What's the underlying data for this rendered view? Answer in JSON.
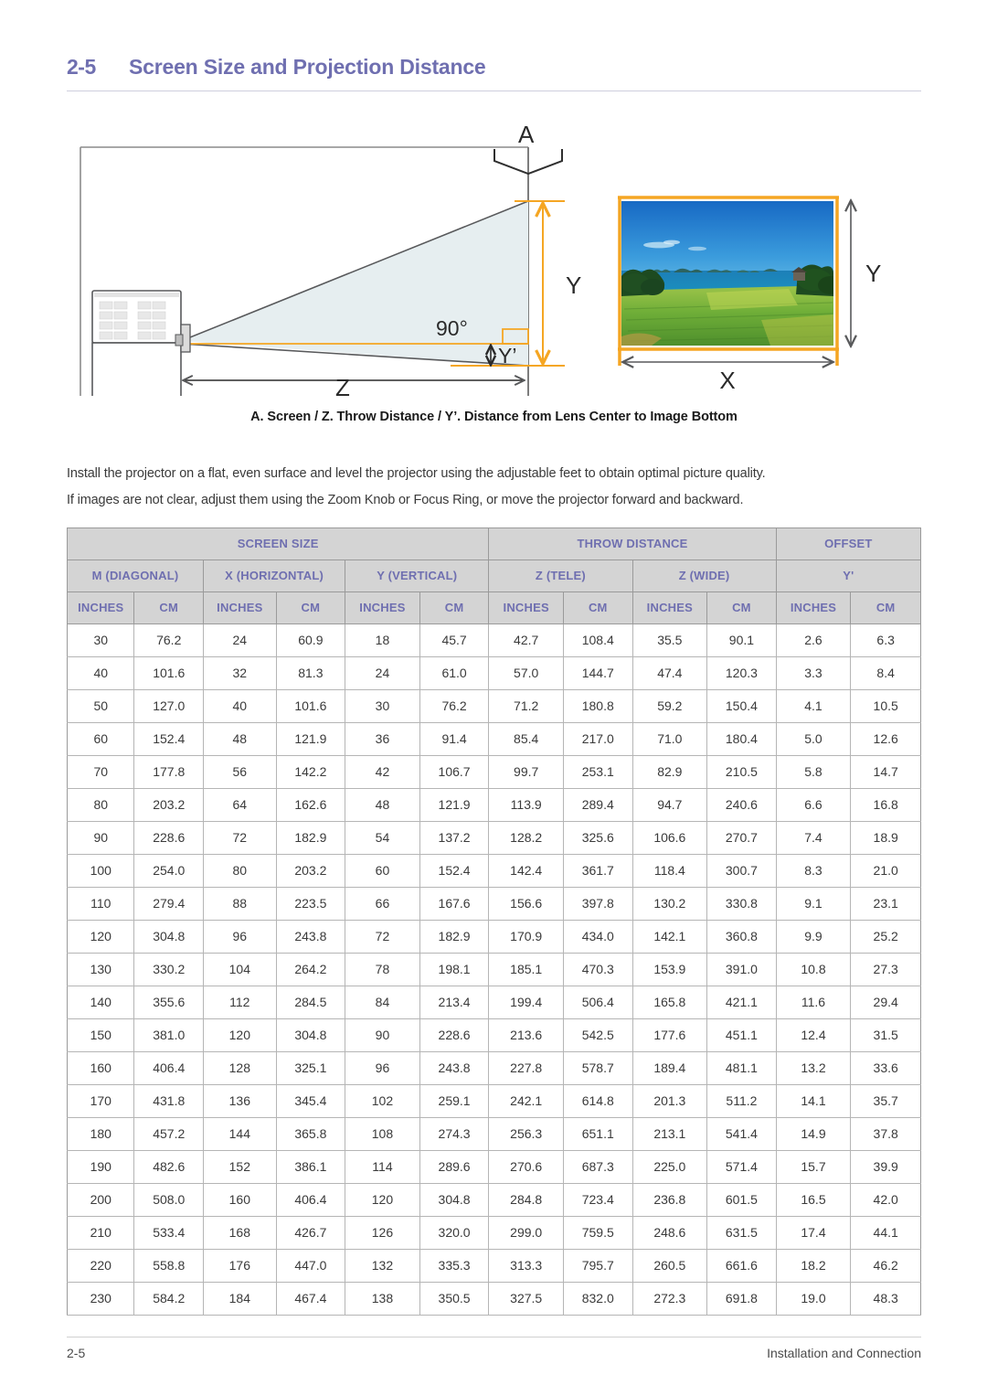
{
  "header": {
    "section_number": "2-5",
    "title": "Screen Size and Projection Distance"
  },
  "figure": {
    "caption": "A. Screen / Z. Throw Distance / Y’. Distance from Lens Center to Image Bottom",
    "labels": {
      "a": "A",
      "y": "Y",
      "y_prime": "Y’",
      "z": "Z",
      "angle": "90°",
      "screen_y": "Y",
      "screen_x": "X"
    },
    "colors": {
      "accent_orange": "#F5A623",
      "beam_fill": "#E6EEF0",
      "line_gray": "#58595B"
    }
  },
  "body": {
    "paragraph1": "Install the projector on a flat, even surface and level the projector using the adjustable feet to obtain optimal picture quality.",
    "paragraph2": "If images are not clear, adjust them using the Zoom Knob or Focus Ring, or move the projector forward and backward."
  },
  "table": {
    "group_headers": [
      {
        "label": "SCREEN SIZE",
        "span": 6
      },
      {
        "label": "THROW DISTANCE",
        "span": 4
      },
      {
        "label": "OFFSET",
        "span": 2
      }
    ],
    "sub_headers": [
      {
        "label": "M (DIAGONAL)",
        "span": 2
      },
      {
        "label": "X (HORIZONTAL)",
        "span": 2
      },
      {
        "label": "Y (VERTICAL)",
        "span": 2
      },
      {
        "label": "Z (TELE)",
        "span": 2
      },
      {
        "label": "Z (WIDE)",
        "span": 2
      },
      {
        "label": "Y'",
        "span": 2
      }
    ],
    "unit_headers": [
      "INCHES",
      "CM",
      "INCHES",
      "CM",
      "INCHES",
      "CM",
      "INCHES",
      "CM",
      "INCHES",
      "CM",
      "INCHES",
      "CM"
    ],
    "rows": [
      [
        "30",
        "76.2",
        "24",
        "60.9",
        "18",
        "45.7",
        "42.7",
        "108.4",
        "35.5",
        "90.1",
        "2.6",
        "6.3"
      ],
      [
        "40",
        "101.6",
        "32",
        "81.3",
        "24",
        "61.0",
        "57.0",
        "144.7",
        "47.4",
        "120.3",
        "3.3",
        "8.4"
      ],
      [
        "50",
        "127.0",
        "40",
        "101.6",
        "30",
        "76.2",
        "71.2",
        "180.8",
        "59.2",
        "150.4",
        "4.1",
        "10.5"
      ],
      [
        "60",
        "152.4",
        "48",
        "121.9",
        "36",
        "91.4",
        "85.4",
        "217.0",
        "71.0",
        "180.4",
        "5.0",
        "12.6"
      ],
      [
        "70",
        "177.8",
        "56",
        "142.2",
        "42",
        "106.7",
        "99.7",
        "253.1",
        "82.9",
        "210.5",
        "5.8",
        "14.7"
      ],
      [
        "80",
        "203.2",
        "64",
        "162.6",
        "48",
        "121.9",
        "113.9",
        "289.4",
        "94.7",
        "240.6",
        "6.6",
        "16.8"
      ],
      [
        "90",
        "228.6",
        "72",
        "182.9",
        "54",
        "137.2",
        "128.2",
        "325.6",
        "106.6",
        "270.7",
        "7.4",
        "18.9"
      ],
      [
        "100",
        "254.0",
        "80",
        "203.2",
        "60",
        "152.4",
        "142.4",
        "361.7",
        "118.4",
        "300.7",
        "8.3",
        "21.0"
      ],
      [
        "110",
        "279.4",
        "88",
        "223.5",
        "66",
        "167.6",
        "156.6",
        "397.8",
        "130.2",
        "330.8",
        "9.1",
        "23.1"
      ],
      [
        "120",
        "304.8",
        "96",
        "243.8",
        "72",
        "182.9",
        "170.9",
        "434.0",
        "142.1",
        "360.8",
        "9.9",
        "25.2"
      ],
      [
        "130",
        "330.2",
        "104",
        "264.2",
        "78",
        "198.1",
        "185.1",
        "470.3",
        "153.9",
        "391.0",
        "10.8",
        "27.3"
      ],
      [
        "140",
        "355.6",
        "112",
        "284.5",
        "84",
        "213.4",
        "199.4",
        "506.4",
        "165.8",
        "421.1",
        "11.6",
        "29.4"
      ],
      [
        "150",
        "381.0",
        "120",
        "304.8",
        "90",
        "228.6",
        "213.6",
        "542.5",
        "177.6",
        "451.1",
        "12.4",
        "31.5"
      ],
      [
        "160",
        "406.4",
        "128",
        "325.1",
        "96",
        "243.8",
        "227.8",
        "578.7",
        "189.4",
        "481.1",
        "13.2",
        "33.6"
      ],
      [
        "170",
        "431.8",
        "136",
        "345.4",
        "102",
        "259.1",
        "242.1",
        "614.8",
        "201.3",
        "511.2",
        "14.1",
        "35.7"
      ],
      [
        "180",
        "457.2",
        "144",
        "365.8",
        "108",
        "274.3",
        "256.3",
        "651.1",
        "213.1",
        "541.4",
        "14.9",
        "37.8"
      ],
      [
        "190",
        "482.6",
        "152",
        "386.1",
        "114",
        "289.6",
        "270.6",
        "687.3",
        "225.0",
        "571.4",
        "15.7",
        "39.9"
      ],
      [
        "200",
        "508.0",
        "160",
        "406.4",
        "120",
        "304.8",
        "284.8",
        "723.4",
        "236.8",
        "601.5",
        "16.5",
        "42.0"
      ],
      [
        "210",
        "533.4",
        "168",
        "426.7",
        "126",
        "320.0",
        "299.0",
        "759.5",
        "248.6",
        "631.5",
        "17.4",
        "44.1"
      ],
      [
        "220",
        "558.8",
        "176",
        "447.0",
        "132",
        "335.3",
        "313.3",
        "795.7",
        "260.5",
        "661.6",
        "18.2",
        "46.2"
      ],
      [
        "230",
        "584.2",
        "184",
        "467.4",
        "138",
        "350.5",
        "327.5",
        "832.0",
        "272.3",
        "691.8",
        "19.0",
        "48.3"
      ]
    ]
  },
  "footer": {
    "left": "2-5",
    "right": "Installation and Connection"
  },
  "theme": {
    "heading_purple": "#6F6FB0",
    "header_fill": "#D4D4D4",
    "body_gray": "#3A3A3A"
  }
}
